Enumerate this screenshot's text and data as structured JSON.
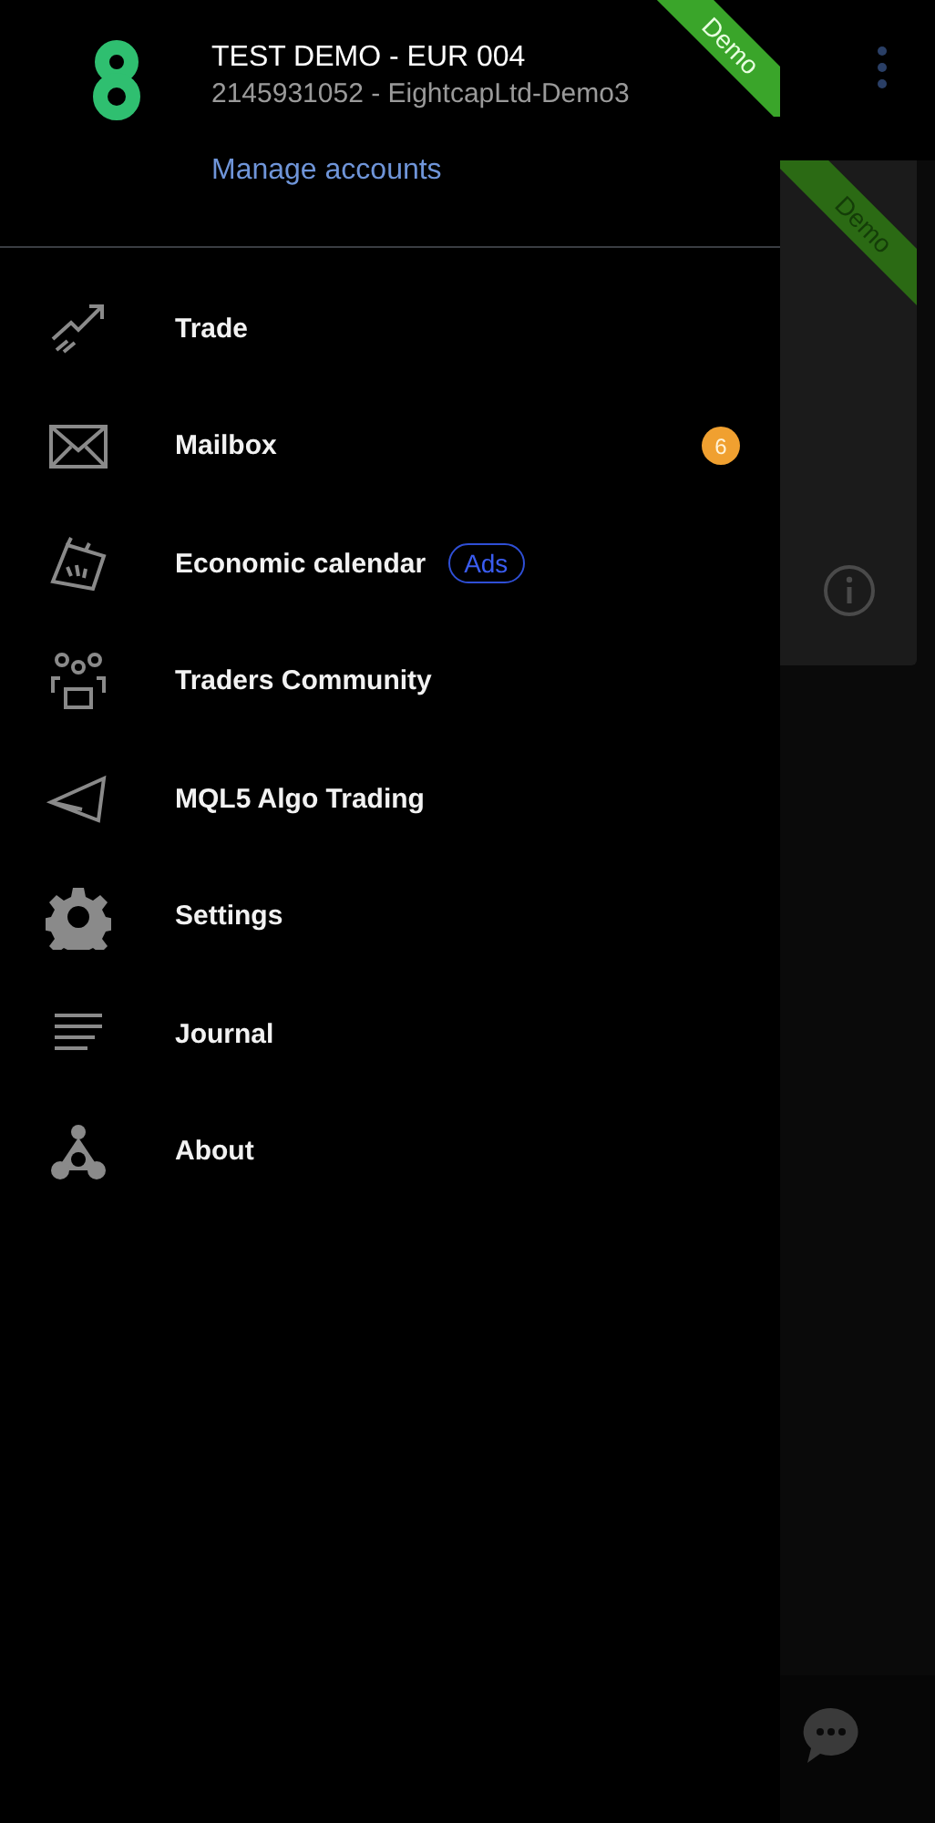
{
  "account": {
    "name": "TEST DEMO - EUR 004",
    "number": "2145931052 - EightcapLtd-Demo3",
    "ribbon": "Demo",
    "manage_link": "Manage accounts"
  },
  "menu": [
    {
      "label": "Trade"
    },
    {
      "label": "Mailbox",
      "badge": "6"
    },
    {
      "label": "Economic calendar",
      "tag": "Ads"
    },
    {
      "label": "Traders Community"
    },
    {
      "label": "MQL5 Algo Trading"
    },
    {
      "label": "Settings"
    },
    {
      "label": "Journal"
    },
    {
      "label": "About"
    }
  ],
  "background": {
    "ribbon": "Demo"
  }
}
